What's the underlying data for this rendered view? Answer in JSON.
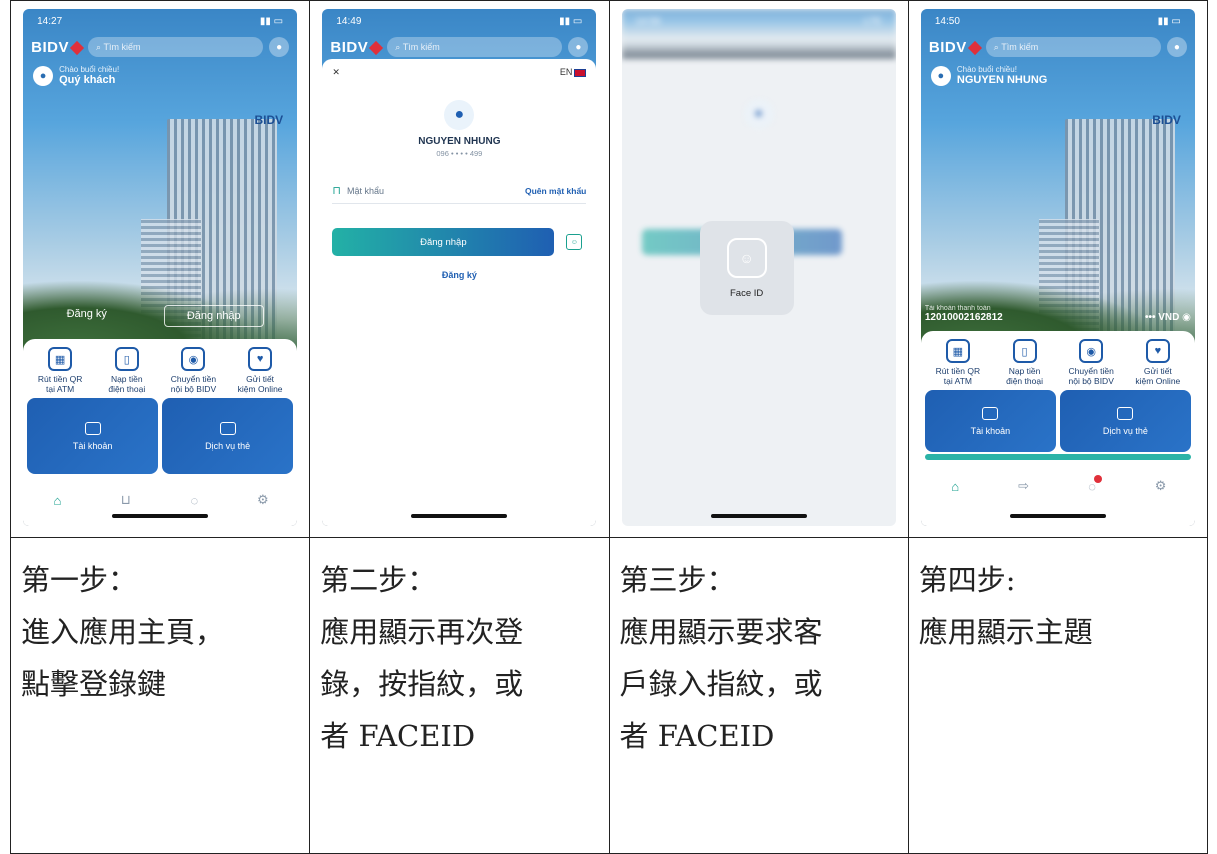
{
  "phone_common": {
    "brand": "BIDV",
    "search_placeholder": "Tìm kiếm",
    "greeting": "Chào buổi chiều!",
    "building_sign": "BIDV"
  },
  "screen1": {
    "time": "14:27",
    "guest_name": "Quý khách",
    "register_label": "Đăng ký",
    "login_label": "Đăng nhập",
    "quick_actions": [
      {
        "label": "Rút tiền QR\ntại ATM"
      },
      {
        "label": "Nạp tiền\nđiện thoại"
      },
      {
        "label": "Chuyển tiền\nnội bộ BIDV"
      },
      {
        "label": "Gửi tiết\nkiệm Online"
      }
    ],
    "cards": [
      {
        "label": "Tài khoản"
      },
      {
        "label": "Dịch vụ thẻ"
      }
    ]
  },
  "screen2": {
    "time": "14:49",
    "language": "EN",
    "user_name": "NGUYEN NHUNG",
    "phone_masked": "096 • • • • 499",
    "password_placeholder": "Mật khẩu",
    "forgot_password": "Quên mật khẩu",
    "login_button": "Đăng nhập",
    "register_link": "Đăng ký"
  },
  "screen3": {
    "time": "14:56",
    "network": "LTE",
    "faceid_label": "Face ID"
  },
  "screen4": {
    "time": "14:50",
    "user_name": "NGUYEN NHUNG",
    "account_label": "Tài khoản thanh toán",
    "account_number": "12010002162812",
    "balance": "••• VND",
    "quick_actions": [
      {
        "label": "Rút tiền QR\ntại ATM"
      },
      {
        "label": "Nạp tiền\nđiện thoại"
      },
      {
        "label": "Chuyển tiền\nnội bộ BIDV"
      },
      {
        "label": "Gửi tiết\nkiệm Online"
      }
    ],
    "cards": [
      {
        "label": "Tài khoản"
      },
      {
        "label": "Dịch vụ thẻ"
      }
    ]
  },
  "steps": [
    {
      "title": "第一步：",
      "desc": "進入應用主頁，\n點擊登錄鍵"
    },
    {
      "title": "第二步：",
      "desc": "應用顯示再次登\n錄，按指紋，或\n者 FACEID"
    },
    {
      "title": "第三步：",
      "desc": "應用顯示要求客\n戶錄入指紋，或\n者 FACEID"
    },
    {
      "title": "第四步:",
      "desc": "應用顯示主題"
    }
  ],
  "colors": {
    "brand_blue": "#1f5fb2",
    "teal": "#1aa08f",
    "bidv_red": "#e0303a"
  }
}
